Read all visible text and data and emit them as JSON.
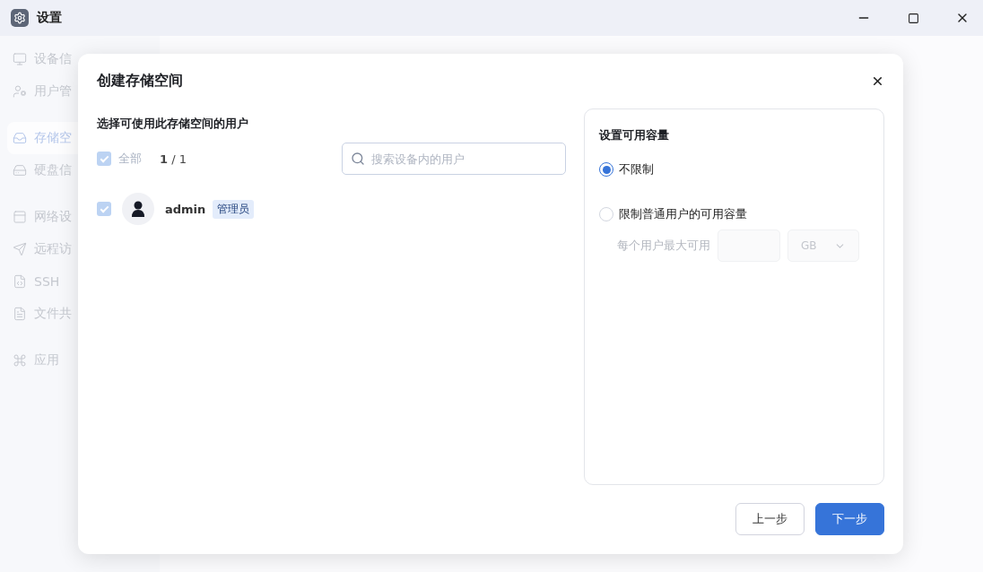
{
  "window": {
    "title": "设置"
  },
  "sidebar": {
    "groups": [
      [
        {
          "label": "设备信",
          "selected": false
        },
        {
          "label": "用户管",
          "selected": false
        }
      ],
      [
        {
          "label": "存储空",
          "selected": true
        },
        {
          "label": "硬盘信",
          "selected": false
        }
      ],
      [
        {
          "label": "网络设",
          "selected": false
        },
        {
          "label": "远程访",
          "selected": false
        },
        {
          "label": "SSH",
          "selected": false
        },
        {
          "label": "文件共",
          "selected": false
        }
      ],
      [
        {
          "label": "应用",
          "selected": false
        }
      ]
    ]
  },
  "dialog": {
    "title": "创建存储空间",
    "users_section": {
      "heading": "选择可使用此存储空间的用户",
      "select_all": {
        "label": "全部",
        "checked": true,
        "disabled": true
      },
      "count_selected": "1",
      "count_total": "/ 1",
      "search": {
        "placeholder": "搜索设备内的用户"
      },
      "users": [
        {
          "name": "admin",
          "role": "管理员",
          "checked": true,
          "disabled": true
        }
      ]
    },
    "capacity": {
      "heading": "设置可用容量",
      "options": [
        {
          "label": "不限制",
          "selected": true
        },
        {
          "label": "限制普通用户的可用容量",
          "selected": false
        }
      ],
      "limit_label": "每个用户最大可用",
      "unit": "GB"
    },
    "buttons": [
      {
        "label": "上一步",
        "kind": "secondary"
      },
      {
        "label": "下一步",
        "kind": "primary"
      }
    ]
  }
}
